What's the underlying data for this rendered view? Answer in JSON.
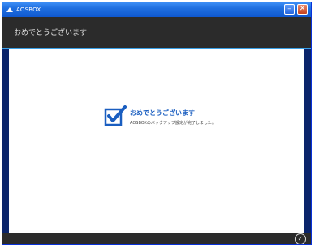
{
  "window": {
    "title": "AOSBOX",
    "minimize_glyph": "–",
    "close_glyph": "✕"
  },
  "header": {
    "title": "おめでとうございます"
  },
  "content": {
    "heading": "おめでとうございます",
    "message": "AOSBOXのバックアップ設定が完了しました。",
    "icon": "checkbox-check-icon"
  },
  "footer": {
    "done_glyph": "✓"
  },
  "colors": {
    "header_bg": "#2b2b2b",
    "accent_blue": "#3aa0e6",
    "heading_blue": "#1a5ec0",
    "titlebar_blue": "#1f6fe0"
  }
}
